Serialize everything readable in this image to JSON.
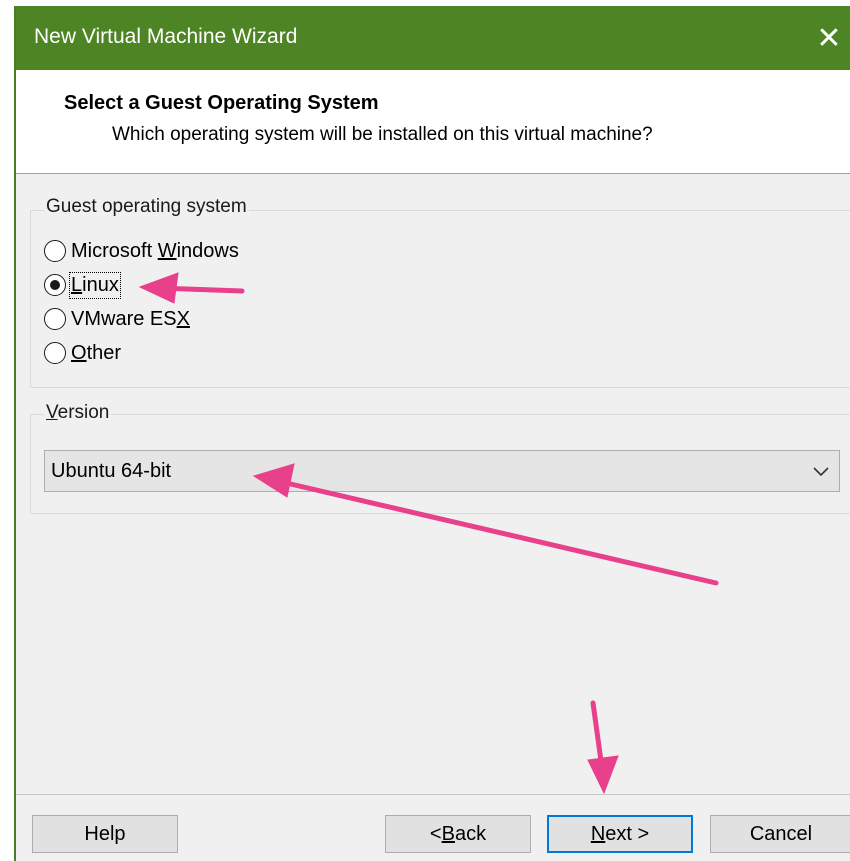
{
  "window": {
    "title": "New Virtual Machine Wizard",
    "close_glyph": "✕"
  },
  "header": {
    "title": "Select a Guest Operating System",
    "subtitle": "Which operating system will be installed on this virtual machine?"
  },
  "guest_os": {
    "group_label": "Guest operating system",
    "options": [
      {
        "pre": "Microsoft ",
        "mnemonic": "W",
        "post": "indows",
        "checked": false
      },
      {
        "pre": "",
        "mnemonic": "L",
        "post": "inux",
        "checked": true
      },
      {
        "pre": "VMware ES",
        "mnemonic": "X",
        "post": "",
        "checked": false
      },
      {
        "pre": "",
        "mnemonic": "O",
        "post": "ther",
        "checked": false
      }
    ]
  },
  "version": {
    "label_mnemonic": "V",
    "label_rest": "ersion",
    "selected": "Ubuntu 64-bit"
  },
  "buttons": {
    "help": "Help",
    "back_prefix": "< ",
    "back_mnemonic": "B",
    "back_rest": "ack",
    "next_mnemonic": "N",
    "next_rest": "ext >",
    "cancel": "Cancel"
  },
  "colors": {
    "titlebar": "#4d8424",
    "annotation_arrow": "#e8408a",
    "focus_border": "#0078d7"
  },
  "icons": [
    "close-icon",
    "radio-icon",
    "chevron-down-icon",
    "annotation-arrow-icon"
  ]
}
